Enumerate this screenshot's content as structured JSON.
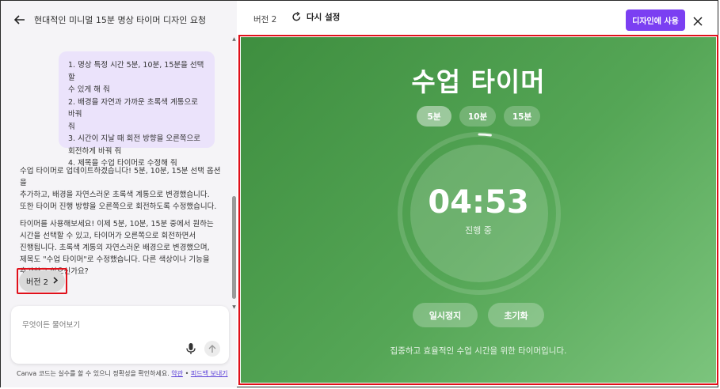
{
  "chat": {
    "title": "현대적인 미니멀 15분 명상 타이머 디자인 요청",
    "user_message_lines": [
      "1. 명상 특정 시간 5분, 10분, 15분을 선택할\n수 있게 해 줘",
      "2. 배경을 자연과 가까운 초록색 계통으로 바꿔\n줘",
      "3. 시간이 지날 때 회전 방향을 오른쪽으로\n회전하게 바꿔 줘",
      "4. 제목을 수업 타이머로 수정해 줘"
    ],
    "assistant_paragraphs": [
      "수업 타이머로 업데이트하겠습니다! 5분, 10분, 15분 선택 옵션을\n추가하고, 배경을 자연스러운 초록색 계통으로 변경했습니다.\n또한 타이머 진행 방향을 오른쪽으로 회전하도록 수정했습니다.",
      "타이머를 사용해보세요! 이제 5분, 10분, 15분 중에서 원하는\n시간을 선택할 수 있고, 타이머가 오른쪽으로 회전하면서\n진행됩니다. 초록색 계통의 자연스러운 배경으로 변경했으며,\n제목도 \"수업 타이머\"로 수정했습니다. 다른 색상이나 기능을\n추가하고 싶으신가요?"
    ],
    "version_chip": "버전 2",
    "input_placeholder": "무엇이든 물어보기",
    "footer_text": "Canva 코드는 실수를 할 수 있으니 정확성을 확인하세요.",
    "footer_link_terms": "약관",
    "footer_separator": "•",
    "footer_link_feedback": "피드백 보내기"
  },
  "preview_header": {
    "version_label": "버전 2",
    "reset_label": "다시 설정",
    "use_button": "디자인에 사용"
  },
  "timer": {
    "title": "수업 타이머",
    "durations": [
      {
        "label": "5분",
        "active": true
      },
      {
        "label": "10분",
        "active": false
      },
      {
        "label": "15분",
        "active": false
      }
    ],
    "time": "04:53",
    "status": "진행 중",
    "progress_fraction": 0.023,
    "pause_label": "일시정지",
    "reset_label": "초기화",
    "caption": "집중하고 효율적인 수업 시간을 위한 타이머입니다."
  },
  "colors": {
    "accent_purple": "#7b3ff2",
    "highlight_red": "#e0101a",
    "green_dark": "#3e8e3f",
    "green_light": "#7cc47d"
  }
}
